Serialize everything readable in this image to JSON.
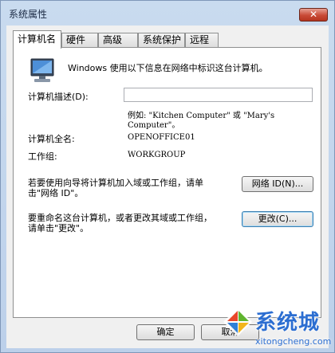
{
  "window": {
    "title": "系统属性",
    "close_label": "✕"
  },
  "tabs": [
    {
      "label": "计算机名",
      "active": true
    },
    {
      "label": "硬件",
      "active": false
    },
    {
      "label": "高级",
      "active": false
    },
    {
      "label": "系统保护",
      "active": false
    },
    {
      "label": "远程",
      "active": false
    }
  ],
  "panel": {
    "intro": "Windows 使用以下信息在网络中标识这台计算机。",
    "description_label": "计算机描述(D):",
    "description_value": "",
    "example_line1": "例如: \"Kitchen Computer\" 或 \"Mary's",
    "example_line2": "Computer\"。",
    "fullname_label": "计算机全名:",
    "fullname_value": "OPENOFFICE01",
    "workgroup_label": "工作组:",
    "workgroup_value": "WORKGROUP",
    "network_text_line1": "若要使用向导将计算机加入域或工作组，请单",
    "network_text_line2": "击\"网络 ID\"。",
    "network_button": "网络 ID(N)...",
    "rename_text_line1": "要重命名这台计算机，或者更改其域或工作组，",
    "rename_text_line2": "请单击\"更改\"。",
    "change_button": "更改(C)..."
  },
  "footer": {
    "ok_button": "确定",
    "cancel_button": "取消"
  },
  "watermark": {
    "brand": "系统城",
    "url": "xitongcheng.com"
  }
}
